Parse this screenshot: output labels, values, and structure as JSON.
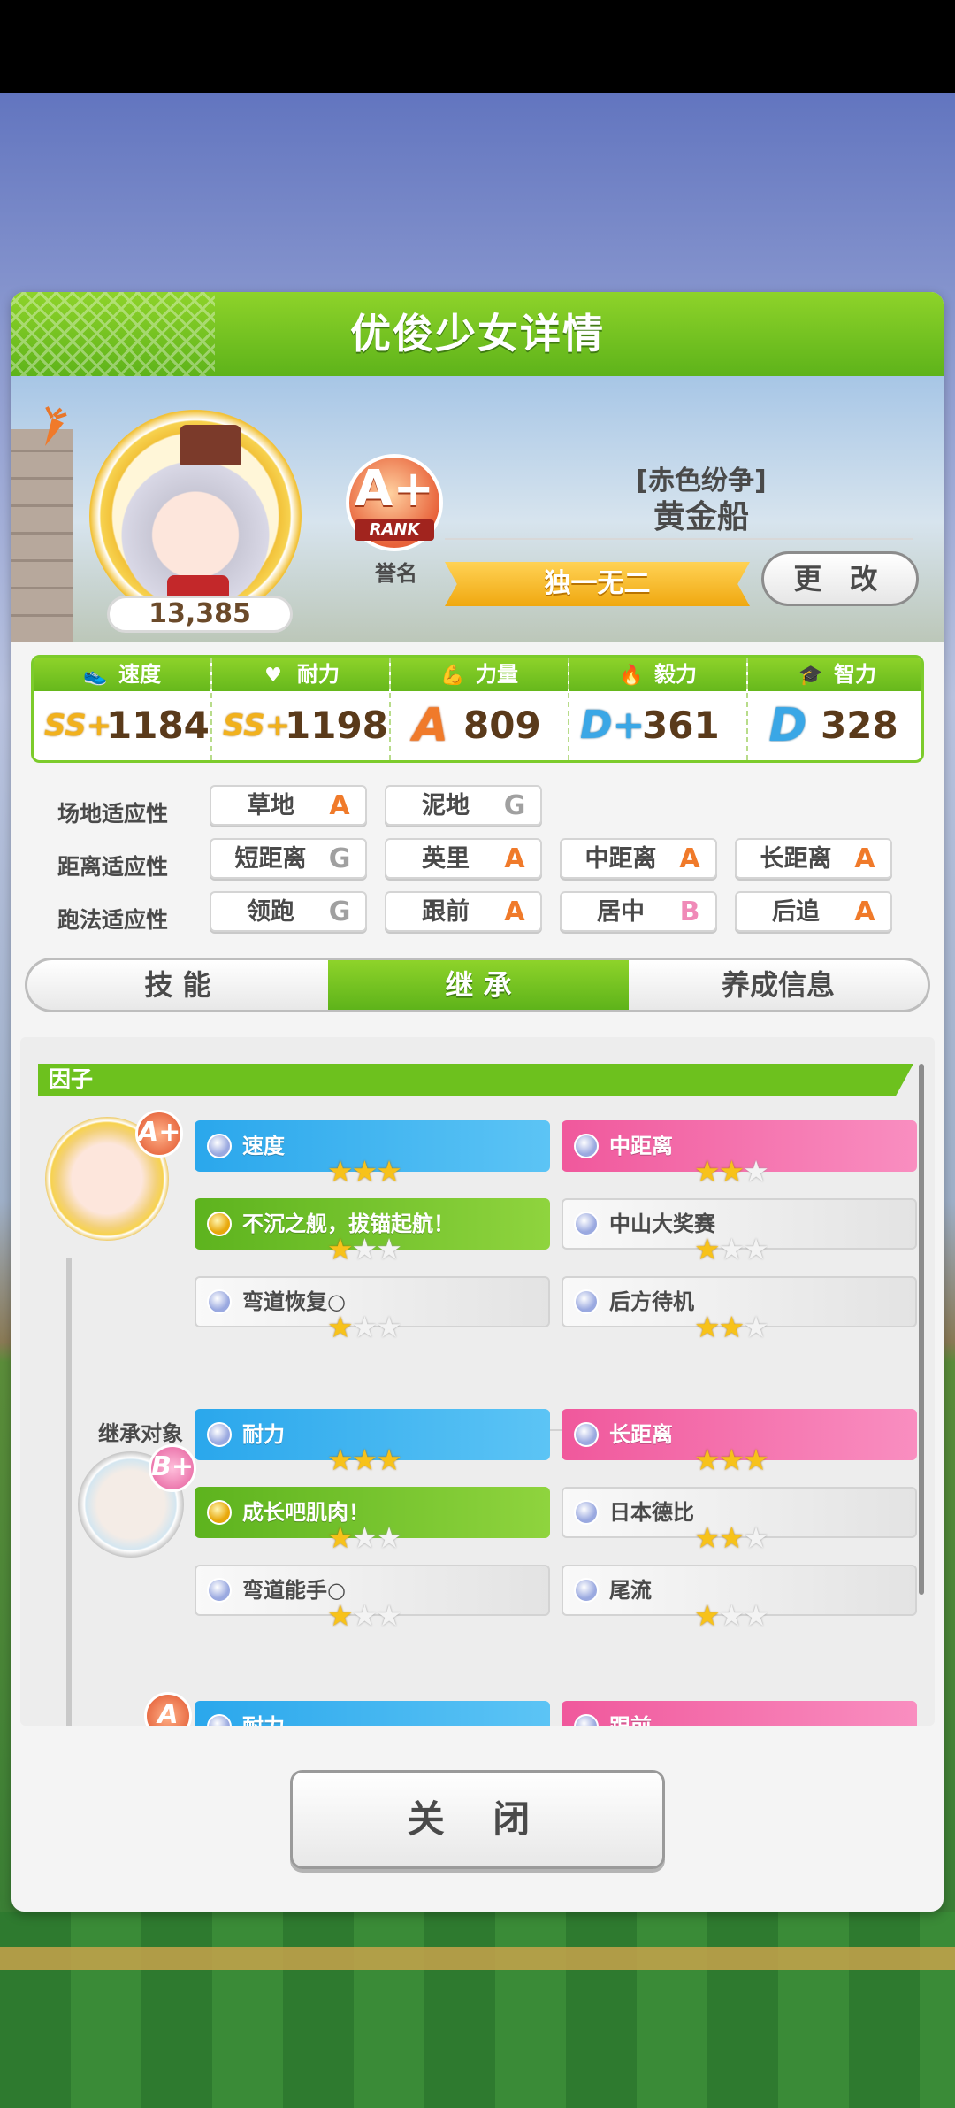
{
  "panel": {
    "title": "优俊少女详情"
  },
  "profile": {
    "fans": "13,385",
    "rank": {
      "grade": "A+",
      "label": "RANK",
      "caption": "誉名"
    },
    "epithet": "[赤色纷争]",
    "name": "黄金船",
    "title_ribbon": "独一无二",
    "change_label": "更 改"
  },
  "stats": [
    {
      "name": "速度",
      "icon": "shoe-icon",
      "grade": "SS+",
      "value": "1184"
    },
    {
      "name": "耐力",
      "icon": "heart-icon",
      "grade": "SS+",
      "value": "1198"
    },
    {
      "name": "力量",
      "icon": "muscle-icon",
      "grade": "A",
      "value": "809"
    },
    {
      "name": "毅力",
      "icon": "flame-icon",
      "grade": "D+",
      "value": "361"
    },
    {
      "name": "智力",
      "icon": "cap-icon",
      "grade": "D",
      "value": "328"
    }
  ],
  "aptitudes": {
    "field": {
      "label": "场地适应性",
      "items": [
        {
          "name": "草地",
          "grade": "A"
        },
        {
          "name": "泥地",
          "grade": "G"
        }
      ]
    },
    "distance": {
      "label": "距离适应性",
      "items": [
        {
          "name": "短距离",
          "grade": "G"
        },
        {
          "name": "英里",
          "grade": "A"
        },
        {
          "name": "中距离",
          "grade": "A"
        },
        {
          "name": "长距离",
          "grade": "A"
        }
      ]
    },
    "style": {
      "label": "跑法适应性",
      "items": [
        {
          "name": "领跑",
          "grade": "G"
        },
        {
          "name": "跟前",
          "grade": "A"
        },
        {
          "name": "居中",
          "grade": "B"
        },
        {
          "name": "后追",
          "grade": "A"
        }
      ]
    }
  },
  "tabs": [
    {
      "label": "技 能"
    },
    {
      "label": "继 承",
      "active": true
    },
    {
      "label": "养成信息"
    }
  ],
  "factors": {
    "header": "因子",
    "self_rank": "A+",
    "self": [
      {
        "name": "速度",
        "color": "blue",
        "stars": 3
      },
      {
        "name": "中距离",
        "color": "pink",
        "stars": 2
      },
      {
        "name": "不沉之舰，拔锚起航！",
        "color": "green",
        "stars": 1
      },
      {
        "name": "中山大奖赛",
        "color": "white",
        "stars": 1
      },
      {
        "name": "弯道恢复○",
        "color": "white",
        "stars": 1
      },
      {
        "name": "后方待机",
        "color": "white",
        "stars": 2
      }
    ],
    "inherit_label": "继承对象",
    "parent_rank": "B+",
    "parent": [
      {
        "name": "耐力",
        "color": "blue",
        "stars": 3
      },
      {
        "name": "长距离",
        "color": "pink",
        "stars": 3
      },
      {
        "name": "成长吧肌肉！",
        "color": "green",
        "stars": 1
      },
      {
        "name": "日本德比",
        "color": "white",
        "stars": 2
      },
      {
        "name": "弯道能手○",
        "color": "white",
        "stars": 1
      },
      {
        "name": "尾流",
        "color": "white",
        "stars": 1
      }
    ],
    "next_rank": "A",
    "next_partial": [
      {
        "name": "耐力",
        "color": "blue"
      },
      {
        "name": "跟前",
        "color": "pink"
      }
    ]
  },
  "close_label": "关 闭"
}
